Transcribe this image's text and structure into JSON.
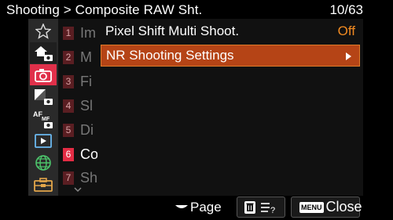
{
  "header": {
    "breadcrumb": "Shooting > Composite RAW Sht.",
    "page": "10/63"
  },
  "sidebar_icons": [
    {
      "name": "star-icon"
    },
    {
      "name": "home-camera-icon"
    },
    {
      "name": "camera-icon",
      "active": true,
      "color": "#e0304a"
    },
    {
      "name": "exposure-camera-icon"
    },
    {
      "name": "af-mf-icon",
      "text": "AF MF"
    },
    {
      "name": "playback-icon"
    },
    {
      "name": "network-globe-icon"
    },
    {
      "name": "toolbox-icon"
    }
  ],
  "sub_menu": [
    {
      "num": "1",
      "frag": "Im"
    },
    {
      "num": "2",
      "frag": "M"
    },
    {
      "num": "3",
      "frag": "Fi"
    },
    {
      "num": "4",
      "frag": "Sl"
    },
    {
      "num": "5",
      "frag": "Di"
    },
    {
      "num": "6",
      "frag": "Co",
      "selected": true
    },
    {
      "num": "7",
      "frag": "Sh"
    }
  ],
  "items": [
    {
      "label": "Pixel Shift Multi Shoot.",
      "value": "Off"
    },
    {
      "label": "NR Shooting Settings",
      "selected": true
    }
  ],
  "footer": {
    "page_label": "Page",
    "menu_badge": "MENU",
    "close_label": "Close"
  },
  "colors": {
    "accent_orange": "#f08a21",
    "selection": "#b54416",
    "brand_red": "#e32c44"
  }
}
